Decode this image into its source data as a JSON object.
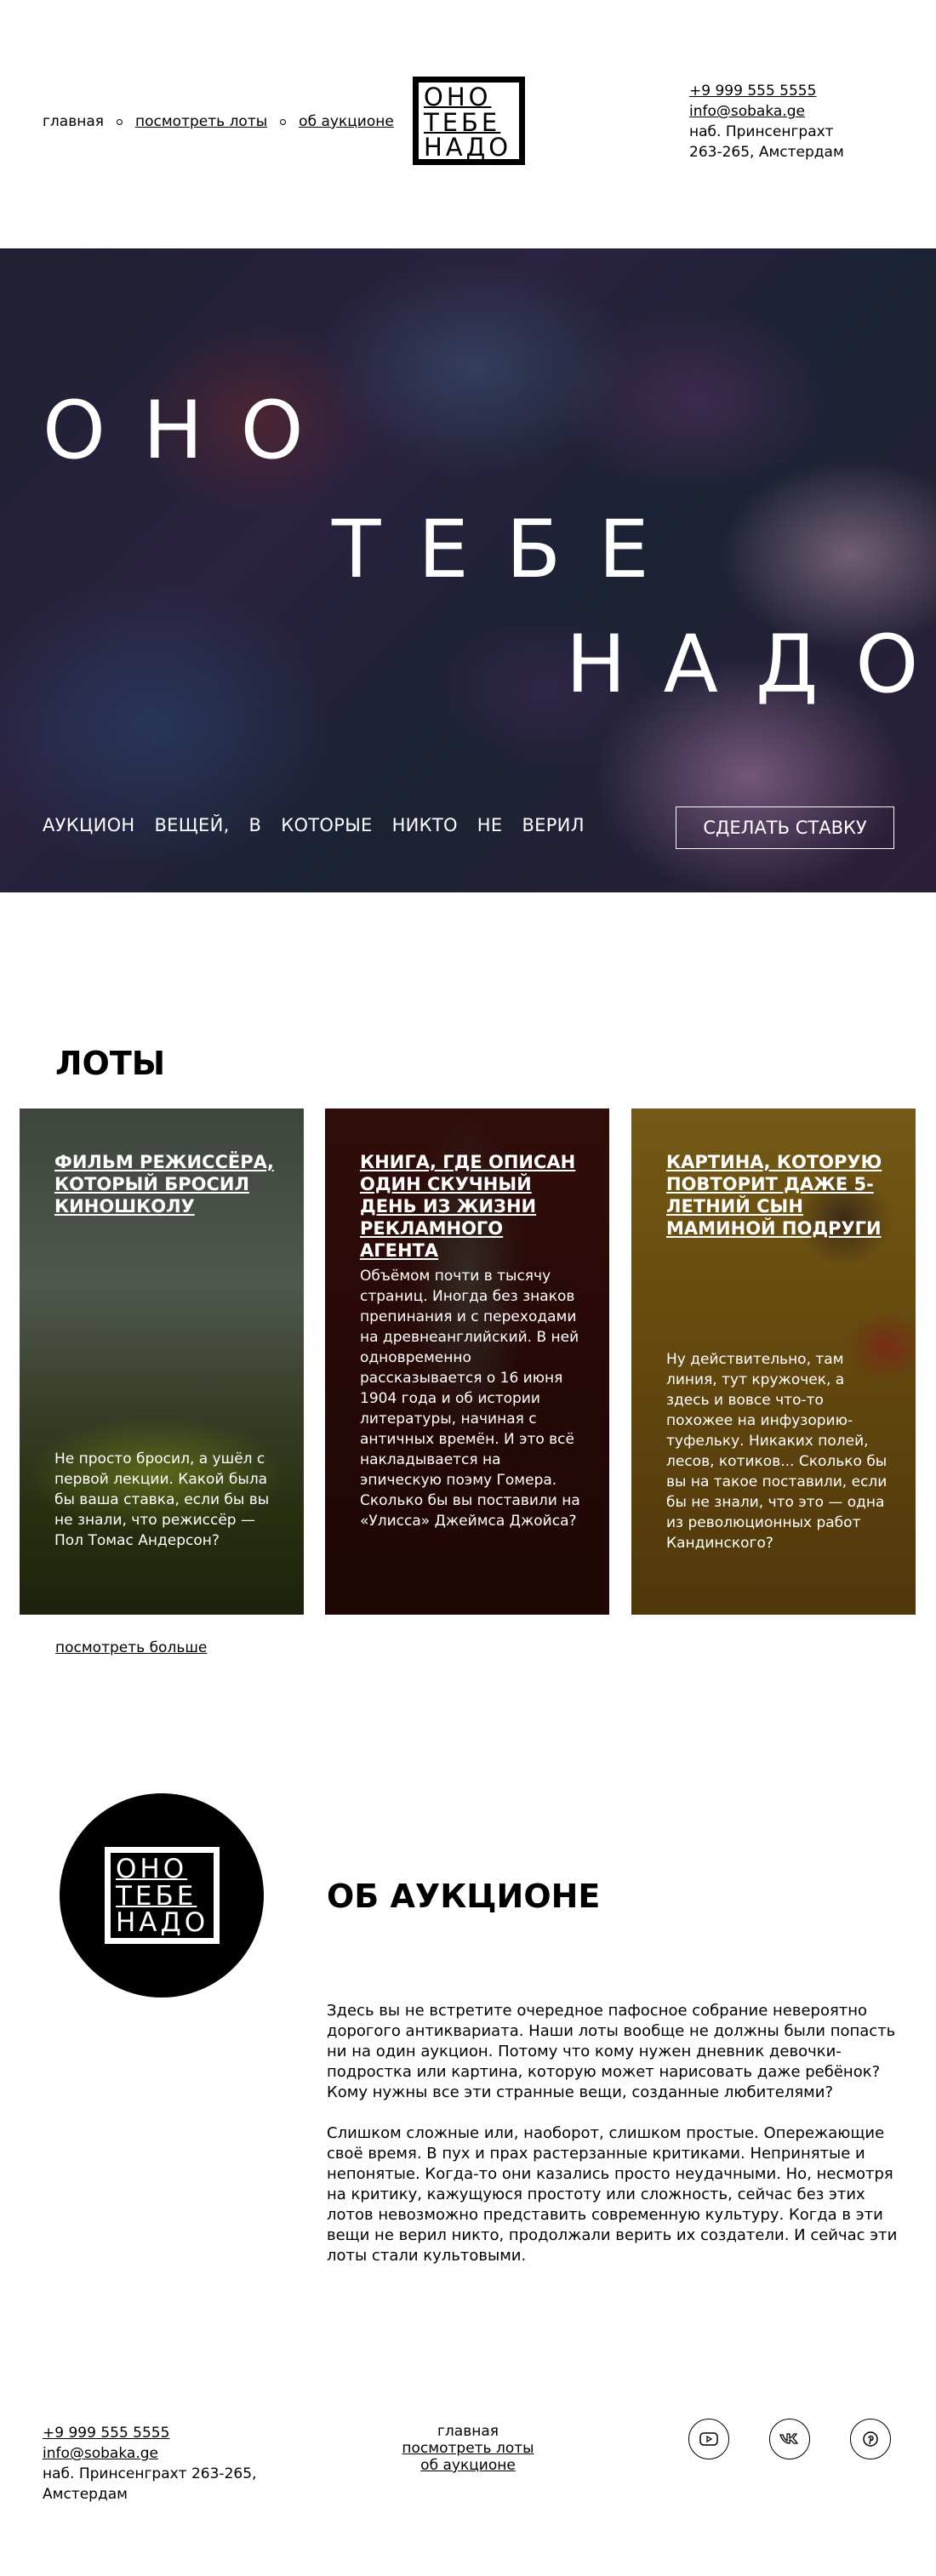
{
  "header": {
    "nav": [
      {
        "label": "главная",
        "underlined": false
      },
      {
        "label": "посмотреть лоты",
        "underlined": true
      },
      {
        "label": "об аукционе",
        "underlined": true
      }
    ],
    "logo": {
      "line1": "ОНО",
      "line2": "ТЕБЕ",
      "line3": "НАДО"
    },
    "contacts": {
      "phone": "+9 999 555 5555",
      "email": "info@sobaka.ge",
      "address": "наб. Принсенграхт 263-265, Амстердам"
    }
  },
  "hero": {
    "words": [
      "ОНО",
      "ТЕБЕ",
      "НАДО"
    ],
    "tagline": "АУКЦИОН ВЕЩЕЙ, В КОТОРЫЕ НИКТО НЕ ВЕРИЛ",
    "button": "СДЕЛАТЬ СТАВКУ"
  },
  "lots": {
    "title": "ЛОТЫ",
    "cards": [
      {
        "title": "ФИЛЬМ РЕЖИССЁРА, КОТОРЫЙ БРОСИЛ КИНОШКОЛУ",
        "text": "Не просто бросил, а ушёл с первой лекции. Какой была бы ваша ставка, если бы вы не знали, что режиссёр — Пол Томас Андерсон?"
      },
      {
        "title": "КНИГА, ГДЕ ОПИСАН ОДИН СКУЧНЫЙ ДЕНЬ ИЗ ЖИЗНИ РЕКЛАМНОГО АГЕНТА",
        "text": "Объёмом почти в тысячу страниц. Иногда без знаков препинания и с переходами на древнеанглийский. В ней одновременно рассказывается о 16 июня 1904 года и об истории литературы, начиная с античных времён. И это всё накладывается на эпическую поэму Гомера. Сколько бы вы поставили на «Улисса» Джеймса Джойса?"
      },
      {
        "title": "КАРТИНА, КОТОРУЮ ПОВТОРИТ ДАЖЕ 5-ЛЕТНИЙ СЫН МАМИНОЙ ПОДРУГИ",
        "text": "Ну действительно, там линия, тут кружочек, а здесь и вовсе что-то похожее на инфузорию-туфельку. Никаких полей, лесов, котиков... Сколько бы вы на такое поставили, если бы не знали, что это — одна из революционных работ Кандинского?"
      }
    ],
    "more": "посмотреть больше"
  },
  "about": {
    "title": "ОБ АУКЦИОНЕ",
    "paragraphs": [
      "Здесь вы не встретите очередное пафосное собрание невероятно дорогого антиквариата. Наши лоты вообще не должны были попасть ни на один аукцион. Потому что кому нужен дневник девочки-подростка или картина, которую может нарисовать даже ребёнок? Кому нужны все эти странные вещи, созданные любителями?",
      "Слишком сложные или, наоборот, слишком простые. Опережающие своё время. В пух и прах растерзанные критиками. Непринятые и непонятые. Когда-то они казались просто неудачными. Но, несмотря на критику, кажущуюся простоту или сложность, сейчас без этих лотов невозможно представить современную культуру. Когда в эти вещи не верил никто, продолжали верить их создатели. И сейчас эти лоты стали культовыми."
    ]
  },
  "footer": {
    "contacts": {
      "phone": "+9 999 555 5555",
      "email": "info@sobaka.ge",
      "address": "наб. Принсенграхт 263-265, Амстердам"
    },
    "nav": [
      "главная",
      "посмотреть лоты",
      "об аукционе"
    ],
    "socials": [
      "youtube-icon",
      "vk-icon",
      "pinterest-icon"
    ]
  }
}
